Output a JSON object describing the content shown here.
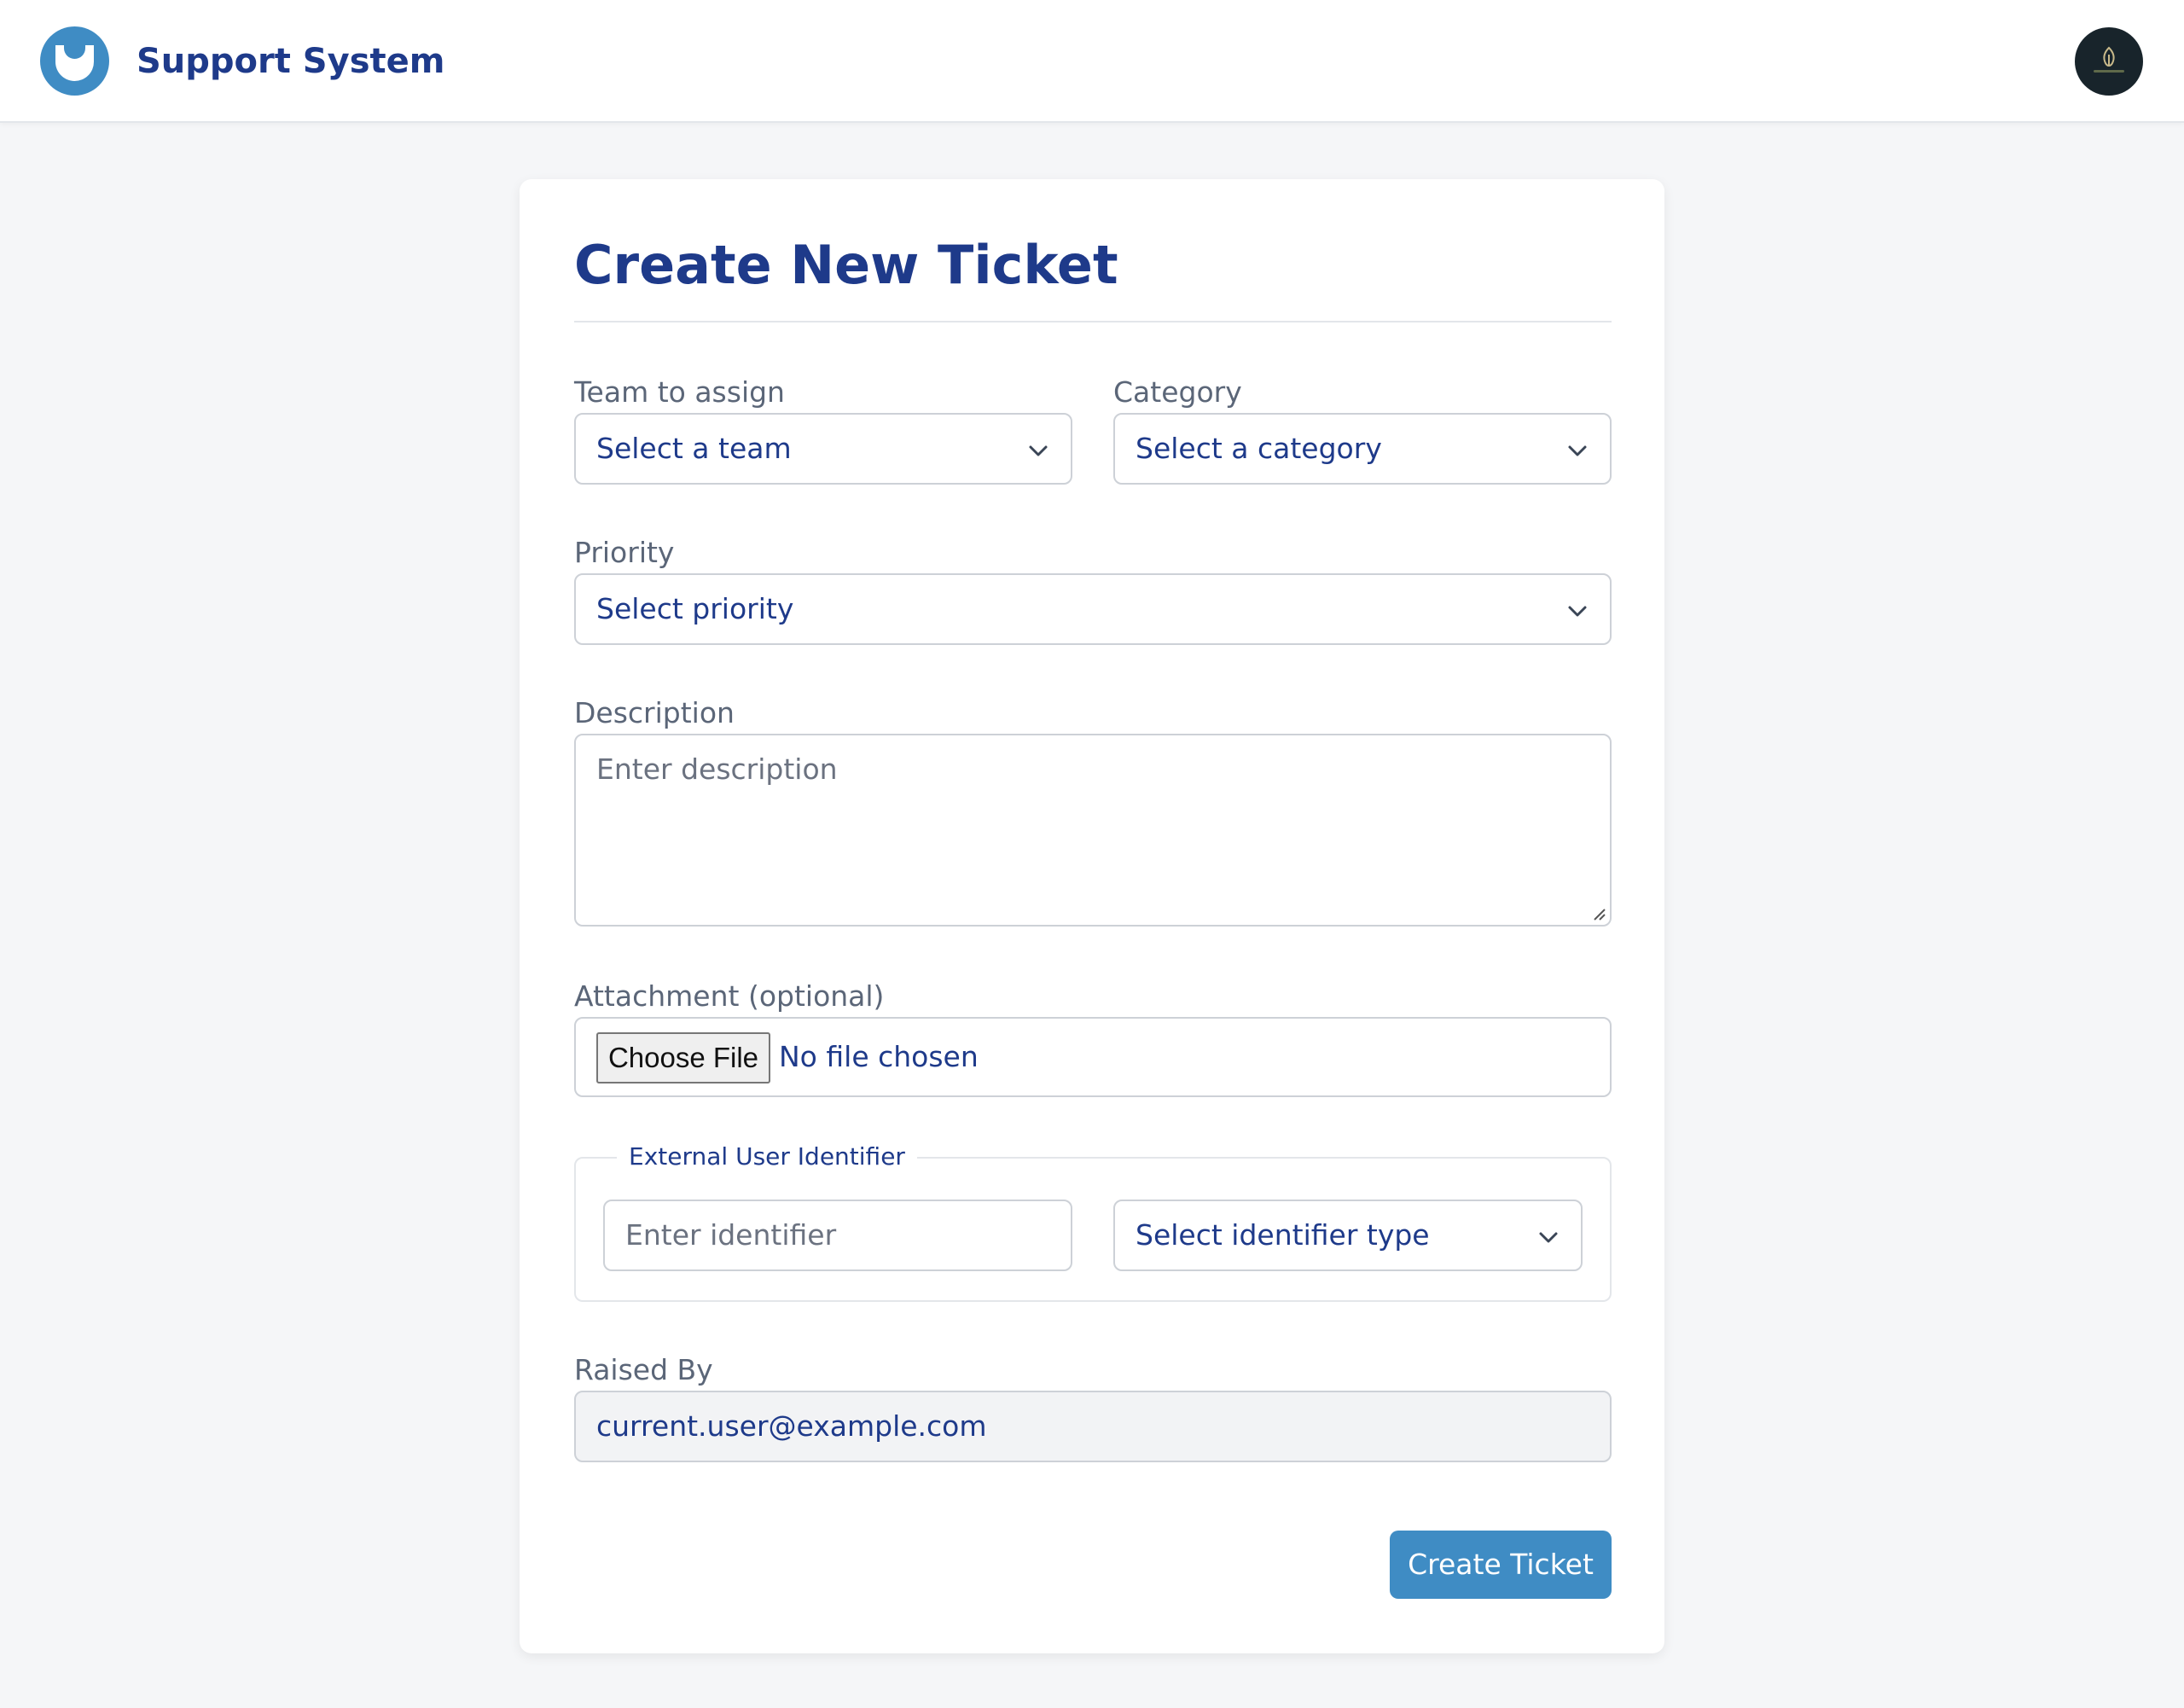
{
  "header": {
    "brand": "Support System",
    "logo_icon": "support-logo-icon",
    "avatar_icon": "user-avatar-icon"
  },
  "form": {
    "title": "Create New Ticket",
    "team": {
      "label": "Team to assign",
      "value": "Select a team"
    },
    "category": {
      "label": "Category",
      "value": "Select a category"
    },
    "priority": {
      "label": "Priority",
      "value": "Select priority"
    },
    "description": {
      "label": "Description",
      "placeholder": "Enter description"
    },
    "attachment": {
      "label": "Attachment (optional)",
      "button": "Choose File",
      "status": "No file chosen"
    },
    "external_id": {
      "legend": "External User Identifier",
      "identifier_placeholder": "Enter identifier",
      "type_value": "Select identifier type"
    },
    "raised_by": {
      "label": "Raised By",
      "value": "current.user@example.com"
    },
    "submit": "Create Ticket"
  },
  "colors": {
    "primary": "#3f8cc4",
    "heading": "#1e3a8a",
    "label": "#5b6678",
    "border": "#cdd1d7",
    "background": "#f5f6f8"
  }
}
